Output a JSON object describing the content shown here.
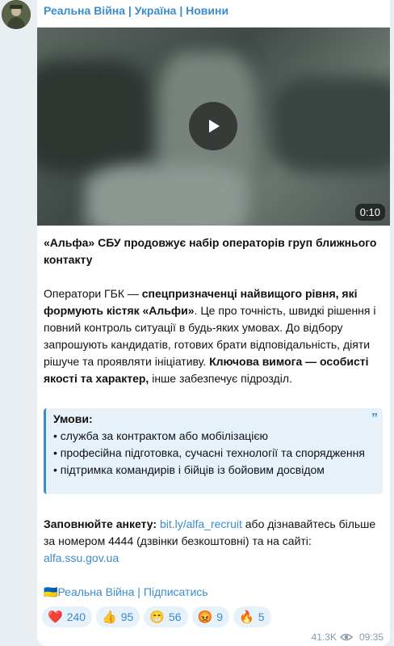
{
  "channel": {
    "name": "Реальна Війна | Україна | Новини"
  },
  "video": {
    "duration": "0:10"
  },
  "post": {
    "title": "«Альфа» СБУ продовжує набір операторів груп ближнього контакту",
    "p2": {
      "a": "Оператори ГБК — ",
      "b": "спецпризначенці найвищого рівня, які формують кістяк «Альфи»",
      "c": ". Це про точність, швидкі рішення і повний контроль ситуації в будь-яких умовах. До відбору запрошують кандидатів, готових брати відповідальність, діяти рішуче та проявляти ініціативу. ",
      "d": "Ключова вимога — особисті якості та характер,",
      "e": " інше забезпечує підрозділ."
    },
    "quote": {
      "title": "Умови:",
      "items": [
        "• служба за контрактом або мобілізацією",
        "• професійна підготовка, сучасні технології та спорядження",
        "• підтримка командирів і бійців із бойовим досвідом"
      ]
    },
    "p3": {
      "label": "Заповнюйте анкету:",
      "link1": "bit.ly/alfa_recruit",
      "mid": " або дізнавайтесь більше за номером 4444 (дзвінки безкоштовні) та на сайті:",
      "link2": "alfa.ssu.gov.ua"
    },
    "footer": {
      "flag": "🇺🇦",
      "channel_link": "Реальна Війна",
      "sep": " | ",
      "subscribe": "Підписатись"
    }
  },
  "reactions": [
    {
      "emoji": "❤️",
      "icon": "heart-icon",
      "count": "240"
    },
    {
      "emoji": "👍",
      "icon": "thumbs-up-icon",
      "count": "95"
    },
    {
      "emoji": "😁",
      "icon": "grin-icon",
      "count": "56"
    },
    {
      "emoji": "😡",
      "icon": "angry-icon",
      "count": "9"
    },
    {
      "emoji": "🔥",
      "icon": "fire-icon",
      "count": "5"
    }
  ],
  "meta": {
    "views": "41.3K",
    "time": "09:35"
  },
  "colors": {
    "accent": "#3a8ccc",
    "background": "#e8eef2",
    "bubble": "#ffffff",
    "quote_bg": "#e7f1fa"
  }
}
